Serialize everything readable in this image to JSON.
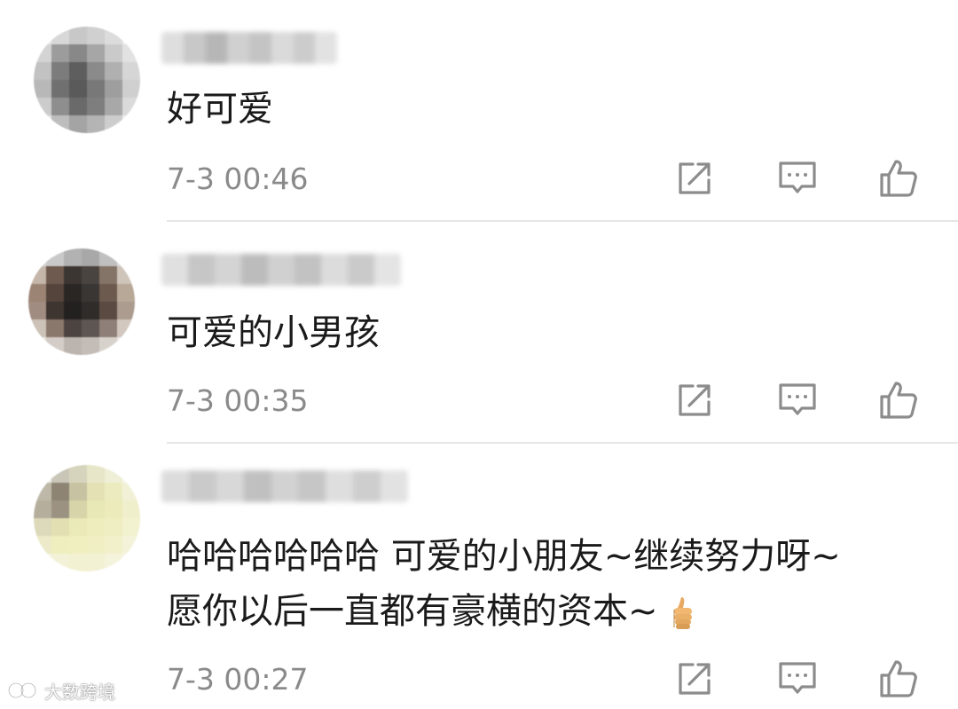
{
  "comments": [
    {
      "text": "好可爱",
      "time": "7-3 00:46"
    },
    {
      "text": "可爱的小男孩",
      "time": "7-3 00:35"
    },
    {
      "text_line1": "哈哈哈哈哈哈 可爱的小朋友~继续努力呀~",
      "text_line2": "愿你以后一直都有豪横的资本~",
      "emoji": "thumbs-up",
      "time": "7-3 00:27"
    }
  ],
  "actions": {
    "repost_icon": "share-icon",
    "comment_icon": "comment-icon",
    "like_icon": "thumbs-up-icon"
  },
  "watermark": {
    "text": "大数跨境",
    "icon": "logo-icon"
  },
  "colors": {
    "text": "#1a1a1a",
    "time": "#8a8a8a",
    "divider": "#e6e6e6",
    "icon": "#8c8c8c"
  }
}
